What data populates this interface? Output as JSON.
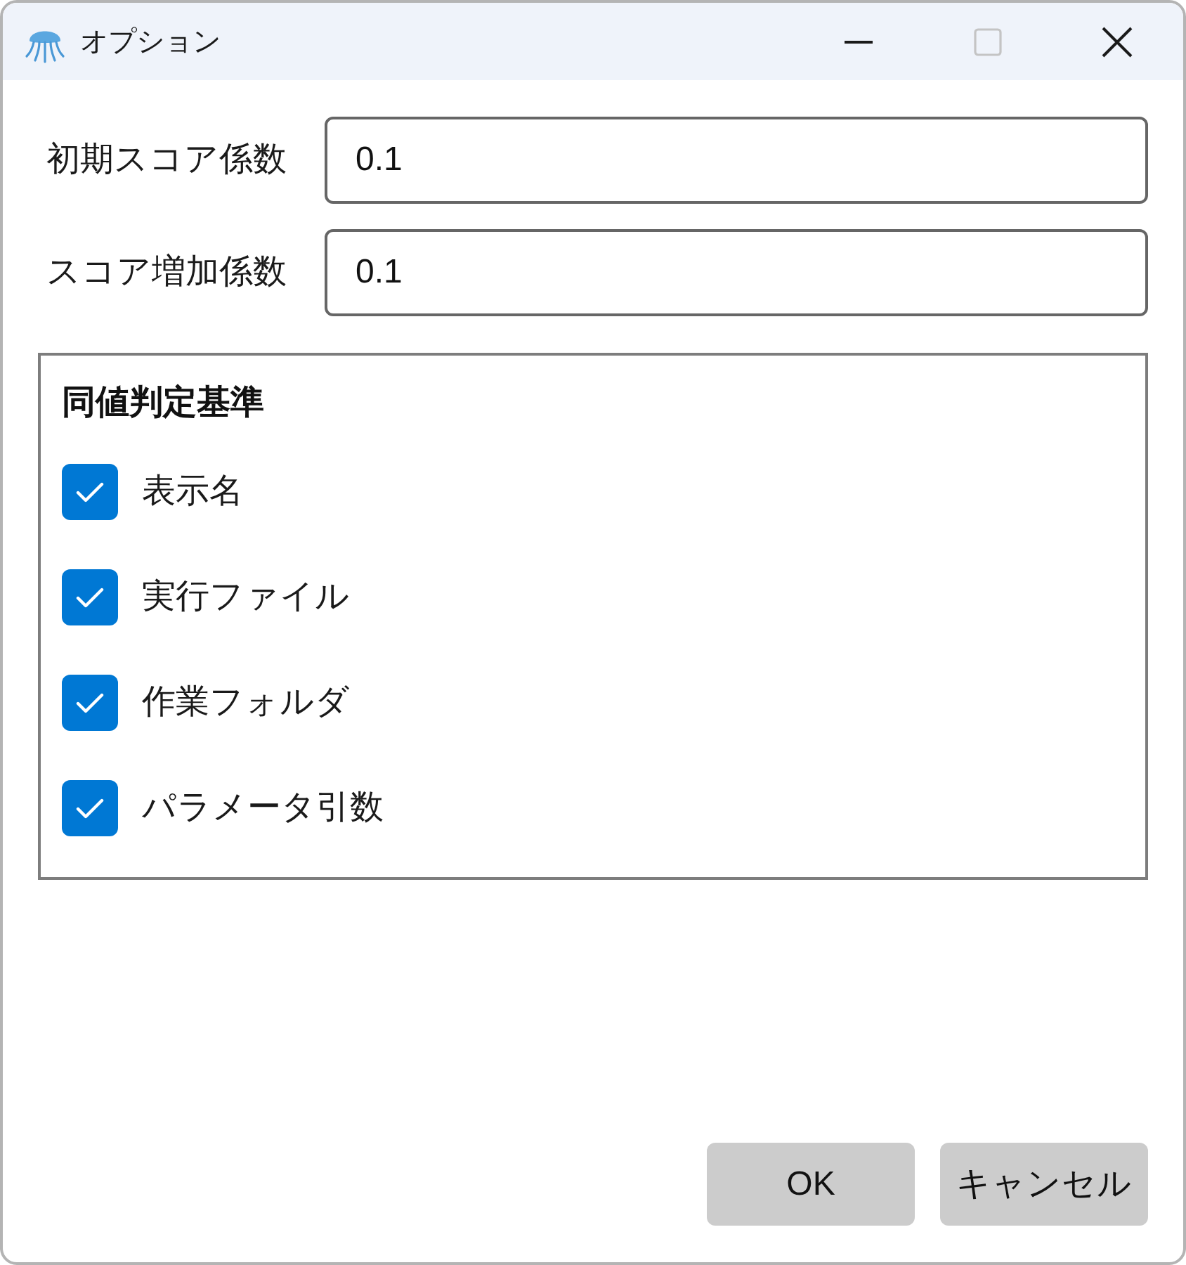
{
  "window": {
    "title": "オプション",
    "controls": [
      {
        "kind": "minimize",
        "disabled": false
      },
      {
        "kind": "maximize",
        "disabled": true
      },
      {
        "kind": "close",
        "disabled": false
      }
    ]
  },
  "fields": [
    {
      "label": "初期スコア係数",
      "value": "0.1"
    },
    {
      "label": "スコア増加係数",
      "value": "0.1"
    }
  ],
  "group": {
    "title": "同値判定基準",
    "options": [
      {
        "label": "表示名",
        "checked": true
      },
      {
        "label": "実行ファイル",
        "checked": true
      },
      {
        "label": "作業フォルダ",
        "checked": true
      },
      {
        "label": "パラメータ引数",
        "checked": true
      }
    ]
  },
  "buttons": [
    {
      "label": "OK"
    },
    {
      "label": "キャンセル"
    }
  ]
}
